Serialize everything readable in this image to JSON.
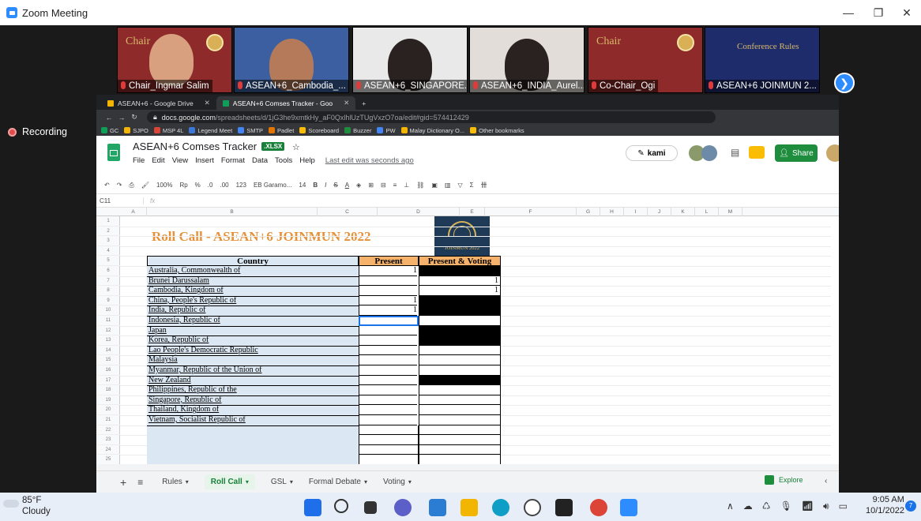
{
  "window": {
    "title": "Zoom Meeting",
    "minimize": "—",
    "restore": "❐",
    "close": "✕"
  },
  "participants": [
    {
      "label": "Chair_Ingmar Salim",
      "overlay": "Chair",
      "bg": "#8e2a2a"
    },
    {
      "label": "ASEAN+6_Cambodia_...",
      "overlay": "",
      "bg": "#3b5fa0"
    },
    {
      "label": "ASEAN+6_SINGAPORE...",
      "overlay": "",
      "bg": "#e9e9e9"
    },
    {
      "label": "ASEAN+6_INDIA_Aurel...",
      "overlay": "",
      "bg": "#e2ddd8"
    },
    {
      "label": "Co-Chair_Ogi",
      "overlay": "Chair",
      "bg": "#8e2a2a"
    },
    {
      "label": "ASEAN+6 JOINMUN 2...",
      "overlay": "Conference Rules",
      "bg": "#1e2c6b"
    }
  ],
  "recording": "Recording",
  "browser": {
    "tabs": [
      {
        "label": "ASEAN+6 - Google Drive",
        "color": "#f4b400"
      },
      {
        "label": "ASEAN+6 Comses Tracker - Goo",
        "color": "#0f9d58"
      }
    ],
    "new_tab": "+",
    "url_host": "docs.google.com",
    "url_path": "/spreadsheets/d/1jG3he9xmtkHy_aF0QxlhlUzTUgVxzO7oa/edit#gid=574412429",
    "bookmarks": [
      "GC",
      "SJPO",
      "MSP 4L",
      "Legend Meet",
      "SMTP",
      "Padlet",
      "Scoreboard",
      "Buzzer",
      "PW",
      "Malay Dictionary O...",
      "Other bookmarks"
    ]
  },
  "sheet": {
    "title": "ASEAN+6 Comses Tracker",
    "badge": ".XLSX",
    "menu": [
      "File",
      "Edit",
      "View",
      "Insert",
      "Format",
      "Data",
      "Tools",
      "Help"
    ],
    "last_edit": "Last edit was seconds ago",
    "kami": "kami",
    "share": "Share",
    "toolbar": [
      "100%",
      "Rp",
      "%",
      ".0",
      ".00",
      "123",
      "EB Garamo...",
      "14",
      "B",
      "I",
      "S",
      "A"
    ],
    "cell_ref": "C11",
    "fx": "fx",
    "columns": [
      "A",
      "B",
      "C",
      "D",
      "E",
      "F",
      "G",
      "H",
      "I",
      "J",
      "K",
      "L",
      "M"
    ],
    "roll_title": "Roll Call - ASEAN+6 JOINMUN 2022",
    "logo_text": "JOINMUN 2022",
    "headers": {
      "country": "Country",
      "present": "Present",
      "voting": "Present & Voting"
    },
    "rows": [
      {
        "country": "Australia, Commonwealth of",
        "present": "1",
        "voting": "",
        "black": true
      },
      {
        "country": "Brunei Darussalam",
        "present": "",
        "voting": "1",
        "black": false
      },
      {
        "country": "Cambodia, Kingdom of",
        "present": "",
        "voting": "1",
        "black": false
      },
      {
        "country": "China, People's Republic of",
        "present": "1",
        "voting": "",
        "black": true
      },
      {
        "country": "India, Republic of",
        "present": "1",
        "voting": "",
        "black": true
      },
      {
        "country": "Indonesia, Republic of",
        "present": "",
        "voting": "",
        "black": false
      },
      {
        "country": "Japan",
        "present": "",
        "voting": "",
        "black": true
      },
      {
        "country": "Korea, Republic of",
        "present": "",
        "voting": "",
        "black": true
      },
      {
        "country": "Lao People's Democratic Republic",
        "present": "",
        "voting": "",
        "black": false
      },
      {
        "country": "Malaysia",
        "present": "",
        "voting": "",
        "black": false
      },
      {
        "country": "Myanmar, Republic of the Union of",
        "present": "",
        "voting": "",
        "black": false
      },
      {
        "country": "New Zealand",
        "present": "",
        "voting": "",
        "black": true
      },
      {
        "country": "Philippines, Republic of the",
        "present": "",
        "voting": "",
        "black": false
      },
      {
        "country": "Singapore, Republic of",
        "present": "",
        "voting": "",
        "black": false
      },
      {
        "country": "Thailand, Kingdom of",
        "present": "",
        "voting": "",
        "black": false
      },
      {
        "country": "Vietnam, Socialist Republic of",
        "present": "",
        "voting": "",
        "black": false
      }
    ],
    "sheet_tabs": [
      "Rules",
      "Roll Call",
      "GSL",
      "Formal Debate",
      "Voting"
    ],
    "active_tab": "Roll Call",
    "explore": "Explore"
  },
  "taskbar": {
    "temp": "85°F",
    "condition": "Cloudy",
    "time": "9:05 AM",
    "date": "10/1/2022",
    "notifications": "7"
  }
}
